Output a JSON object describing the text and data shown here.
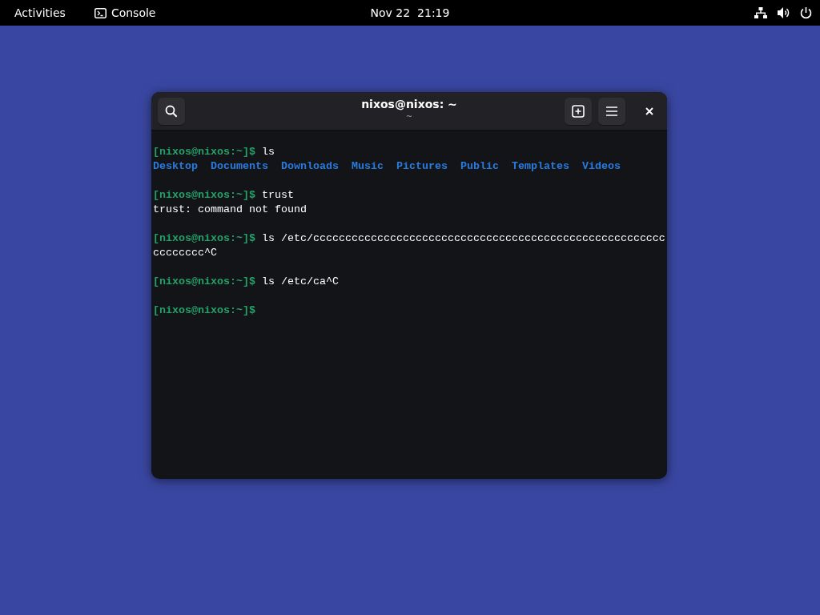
{
  "top_bar": {
    "activities": "Activities",
    "app": {
      "label": "Console"
    },
    "clock": "Nov 22  21:19"
  },
  "window": {
    "title": "nixos@nixos: ~",
    "subtitle": "~",
    "blocks": [
      [
        [
          {
            "kind": "prompt",
            "text": "[nixos@nixos:~]$"
          },
          {
            "kind": "text",
            "text": " ls"
          }
        ],
        [
          {
            "kind": "dir",
            "text": "Desktop"
          },
          {
            "kind": "dir",
            "text": "Documents"
          },
          {
            "kind": "dir",
            "text": "Downloads"
          },
          {
            "kind": "dir",
            "text": "Music"
          },
          {
            "kind": "dir",
            "text": "Pictures"
          },
          {
            "kind": "dir",
            "text": "Public"
          },
          {
            "kind": "dir",
            "text": "Templates"
          },
          {
            "kind": "dir",
            "text": "Videos"
          }
        ]
      ],
      [
        [
          {
            "kind": "prompt",
            "text": "[nixos@nixos:~]$"
          },
          {
            "kind": "text",
            "text": " trust"
          }
        ],
        [
          {
            "kind": "text",
            "text": "trust: command not found"
          }
        ]
      ],
      [
        [
          {
            "kind": "prompt",
            "text": "[nixos@nixos:~]$"
          },
          {
            "kind": "text",
            "text": " ls /etc/ccccccccccccccccccccccccccccccccccccccccccccccccccccccc"
          }
        ],
        [
          {
            "kind": "text",
            "text": "cccccccc^C"
          }
        ]
      ],
      [
        [
          {
            "kind": "prompt",
            "text": "[nixos@nixos:~]$"
          },
          {
            "kind": "text",
            "text": " ls /etc/ca^C"
          }
        ]
      ],
      [
        [
          {
            "kind": "prompt",
            "text": "[nixos@nixos:~]$"
          }
        ]
      ]
    ]
  }
}
